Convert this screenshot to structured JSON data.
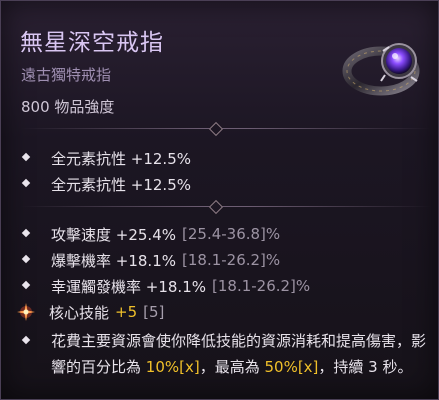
{
  "item": {
    "name": "無星深空戒指",
    "type": "遠古獨特戒指",
    "power": "800 物品強度"
  },
  "implicits": [
    {
      "label": "全元素抗性 +12.5%"
    },
    {
      "label": "全元素抗性 +12.5%"
    }
  ],
  "affixes": [
    {
      "label": "攻擊速度 +25.4%",
      "range": "[25.4-36.8]%"
    },
    {
      "label": "爆擊機率 +18.1%",
      "range": "[18.1-26.2]%"
    },
    {
      "label": "幸運觸發機率 +18.1%",
      "range": "[18.1-26.2]%"
    }
  ],
  "skill": {
    "label": "核心技能",
    "value": "+5",
    "range": "[5]"
  },
  "unique_power": {
    "part1": "花費主要資源會使你降低技能的資源消耗和提高傷害，影響的百分比為 ",
    "value1": "10%[x]",
    "part2": "，最高為 ",
    "value2": "50%[x]",
    "part3": "，持續 3 秒。"
  },
  "colors": {
    "title": "#d9c6f2",
    "accent_gold": "#f0c02a",
    "range_grey": "#9c93a3"
  },
  "icons": [
    "ring-item-icon",
    "diamond-bullet-icon",
    "sparkle-unique-icon"
  ]
}
